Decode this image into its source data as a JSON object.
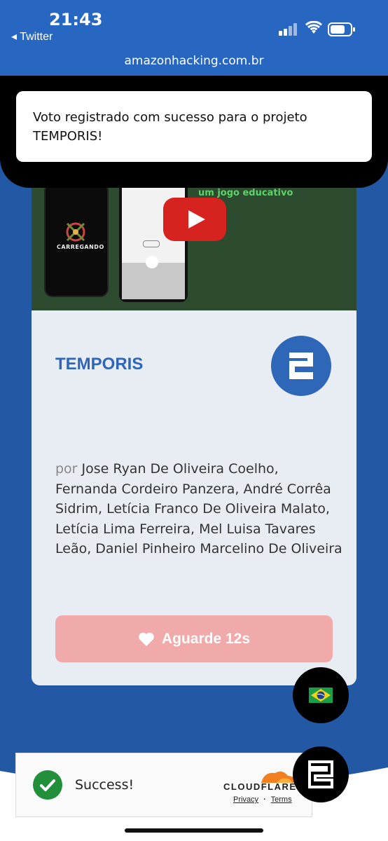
{
  "status": {
    "time": "21:43",
    "back_label": "◂ Twitter"
  },
  "url": "amazonhacking.com.br",
  "toast": {
    "message": "Voto registrado com sucesso para o projeto TEMPORIS!"
  },
  "video": {
    "overlay_text": "um jogo educativo",
    "phone_label": "CARREGANDO"
  },
  "project": {
    "title": "TEMPORIS",
    "authors_prefix": "por",
    "authors": "Jose Ryan De Oliveira Coelho, Fernanda Cordeiro Panzera, André Corrêa Sidrim, Letícia Franco De Oliveira Malato, Letícia Lima Ferreira, Mel Luisa Tavares Leão, Daniel Pinheiro Marcelino De Oliveira"
  },
  "vote_button": {
    "label": "Aguarde 12s",
    "icon": "heart-icon"
  },
  "cloudflare": {
    "status": "Success!",
    "brand": "CLOUDFLARE",
    "privacy": "Privacy",
    "separator": "·",
    "terms": "Terms"
  },
  "colors": {
    "primary": "#2f67b8",
    "background": "#2358a5",
    "vote_disabled": "#f1aaaa",
    "success": "#228f3b"
  }
}
